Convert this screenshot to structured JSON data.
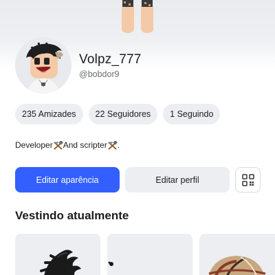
{
  "profile": {
    "username": "Volpz_777",
    "handle": "@bobdor9",
    "bio_parts": [
      "Developer",
      " And scripter",
      "."
    ]
  },
  "stats": {
    "friends": "235 Amizades",
    "followers": "22 Seguidores",
    "following": "1 Seguindo"
  },
  "actions": {
    "edit_avatar": "Editar aparência",
    "edit_profile": "Editar perfil"
  },
  "wearing": {
    "title": "Vestindo atualmente"
  },
  "colors": {
    "primary": "#335fff",
    "pill_bg": "#eceef1"
  },
  "icons": [
    "hammer-pick-icon",
    "qr-code-icon"
  ]
}
